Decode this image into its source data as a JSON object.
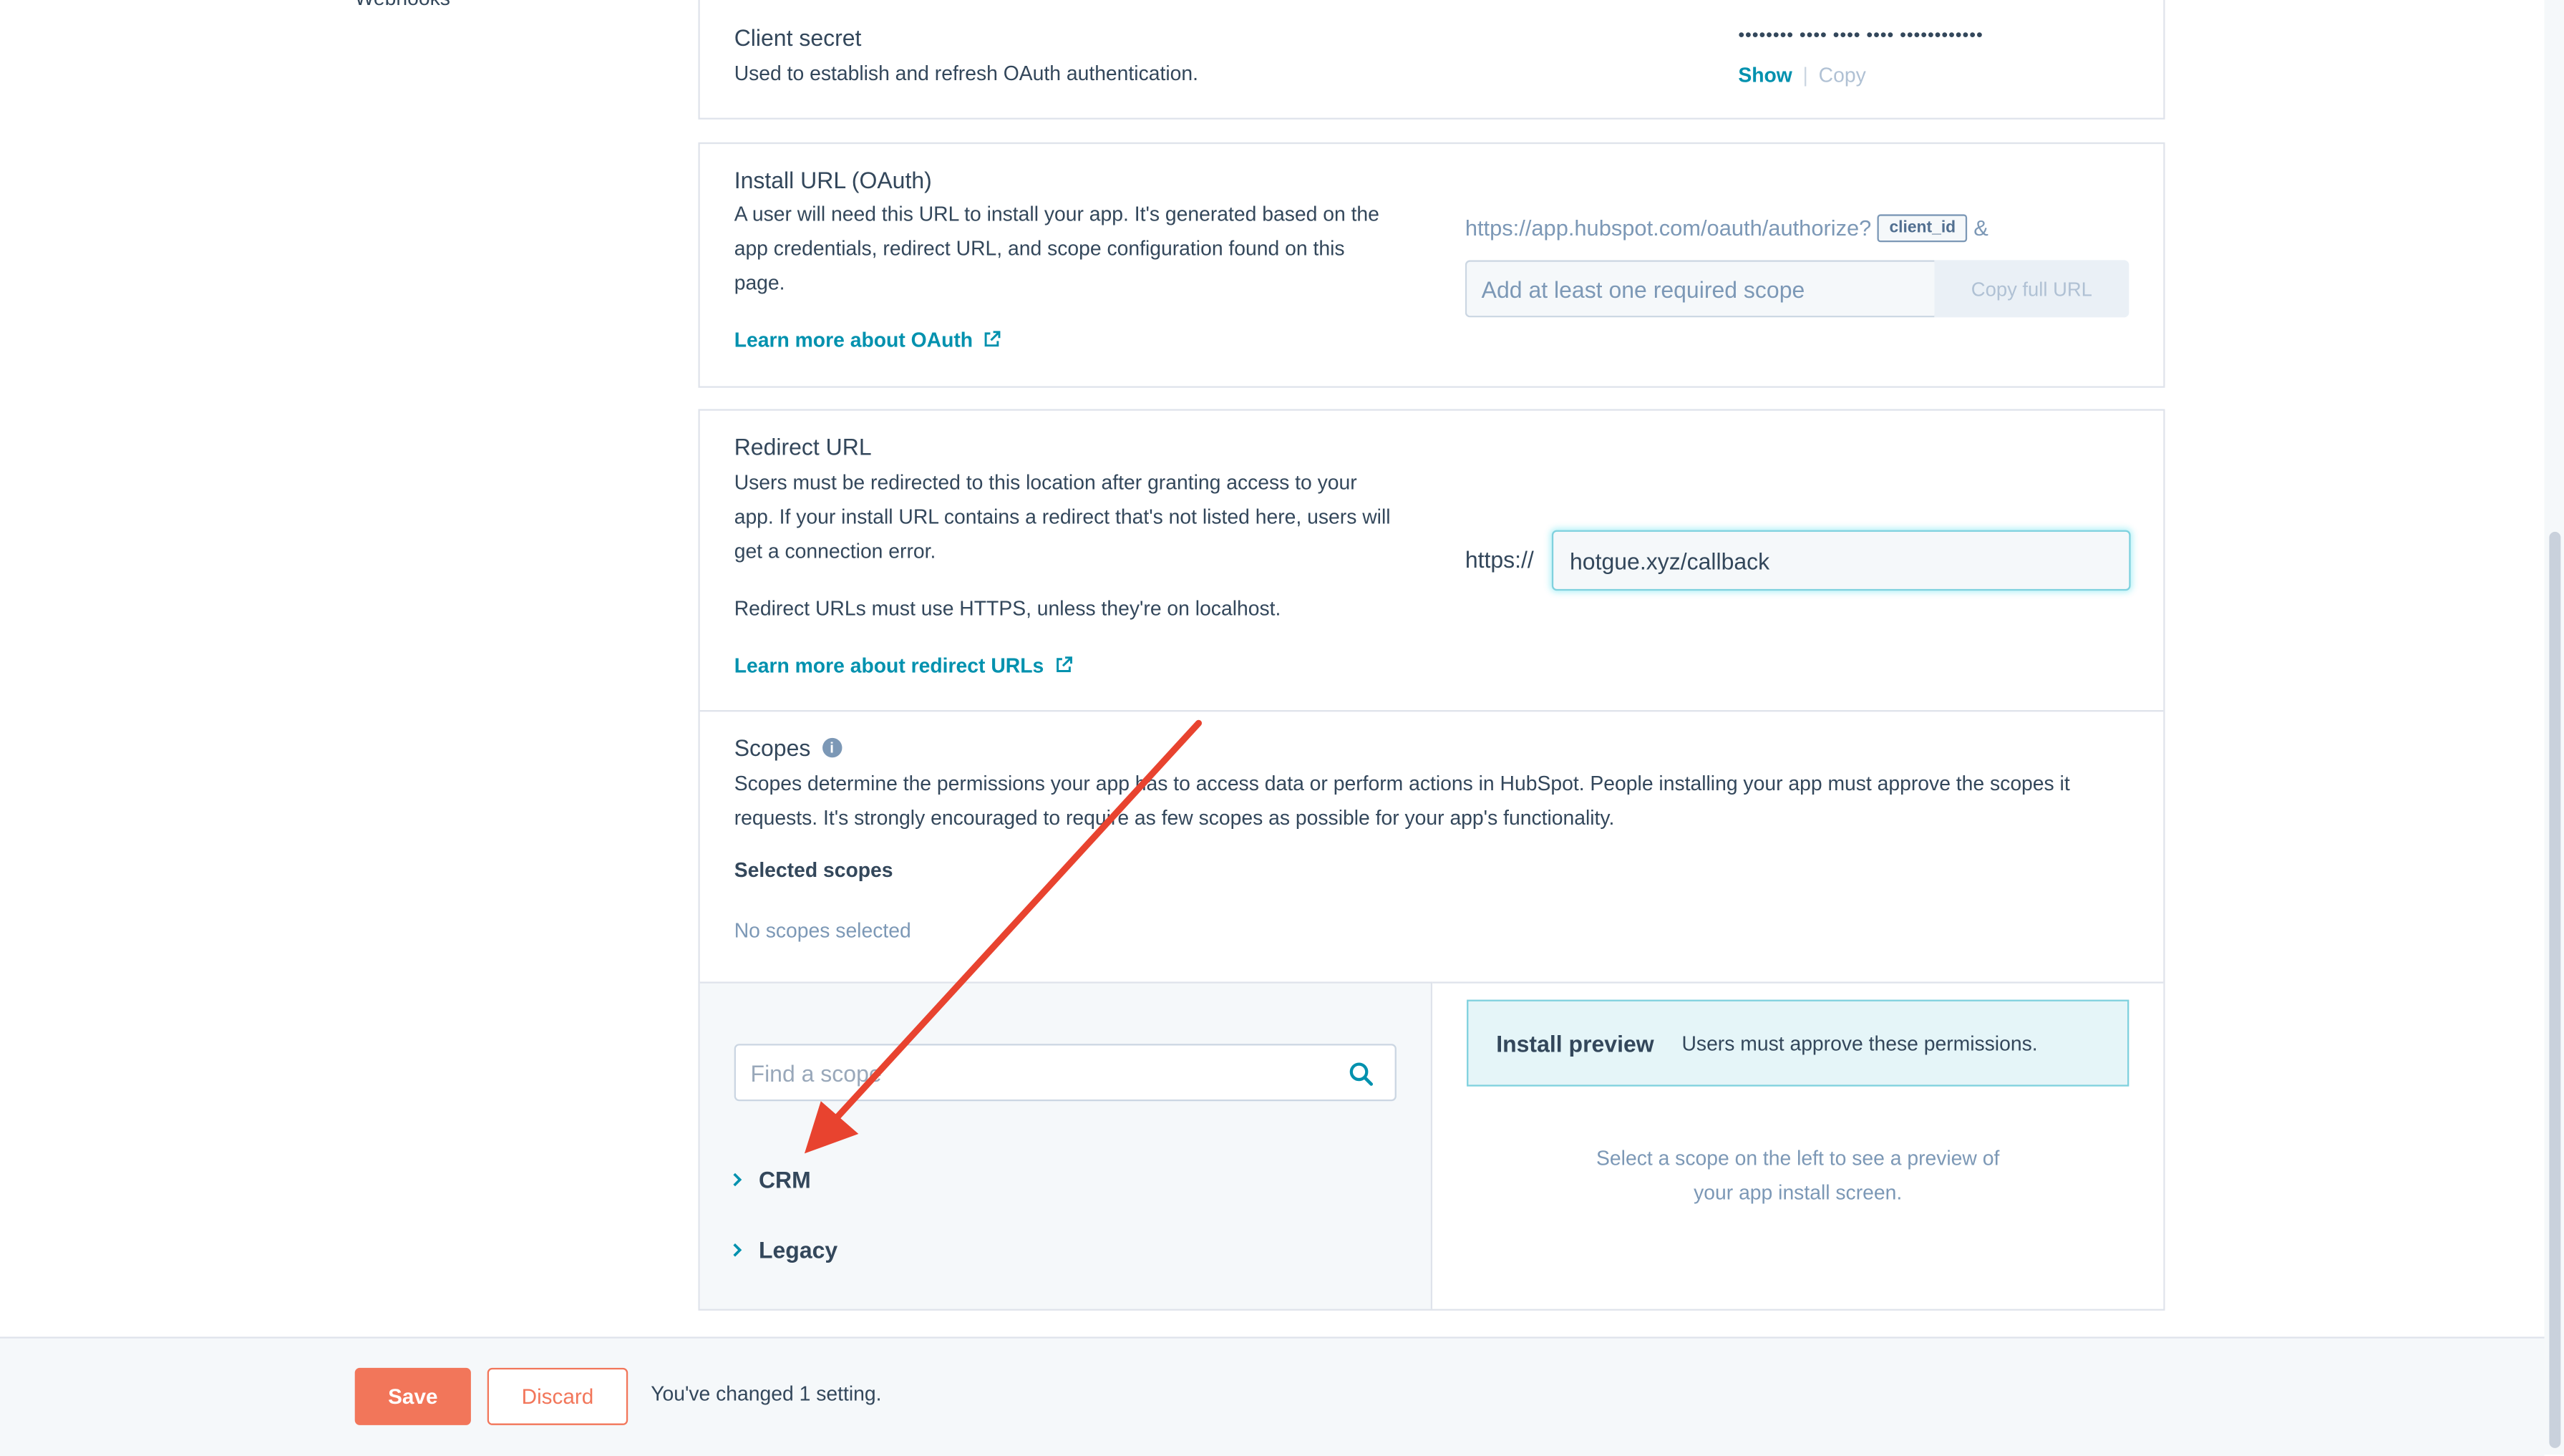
{
  "sidebar": {
    "cut_item": "Webhooks"
  },
  "client_secret": {
    "title": "Client secret",
    "description": "Used to establish and refresh OAuth authentication.",
    "masked_value": "•••••••• •••• •••• •••• ••••••••••••",
    "show_label": "Show",
    "separator": "|",
    "copy_label": "Copy"
  },
  "install_url": {
    "title": "Install URL (OAuth)",
    "description_lines": [
      "A user will need this URL to install your app. It's generated based on the",
      "app credentials, redirect URL, and scope configuration found on this",
      "page."
    ],
    "learn_more": "Learn more about OAuth",
    "url_prefix": "https://app.hubspot.com/oauth/authorize?",
    "client_id_tag": "client_id",
    "ampersand": "&",
    "scope_placeholder": "Add at least one required scope",
    "copy_full_url": "Copy full URL"
  },
  "redirect_url": {
    "title": "Redirect URL",
    "description_lines": [
      "Users must be redirected to this location after granting access to your",
      "app. If your install URL contains a redirect that's not listed here, users will",
      "get a connection error."
    ],
    "https_note": "Redirect URLs must use HTTPS, unless they're on localhost.",
    "learn_more": "Learn more about redirect URLs",
    "prefix": "https://",
    "value": "hotgue.xyz/callback"
  },
  "scopes": {
    "title": "Scopes",
    "description_lines": [
      "Scopes determine the permissions your app has to access data or perform actions in HubSpot. People installing your app must approve the scopes it",
      "requests. It's strongly encouraged to require as few scopes as possible for your app's functionality."
    ],
    "selected_label": "Selected scopes",
    "none_selected": "No scopes selected",
    "search_placeholder": "Find a scope",
    "categories": [
      {
        "label": "CRM"
      },
      {
        "label": "Legacy"
      }
    ],
    "preview_title": "Install preview",
    "preview_subtitle": "Users must approve these permissions.",
    "preview_empty_lines": [
      "Select a scope on the left to see a preview of",
      "your app install screen."
    ]
  },
  "footer": {
    "save": "Save",
    "discard": "Discard",
    "status": "You've changed 1 setting."
  },
  "colors": {
    "link": "#0091ae",
    "primary_button": "#f2765a",
    "annotation_arrow": "#e8432f"
  }
}
